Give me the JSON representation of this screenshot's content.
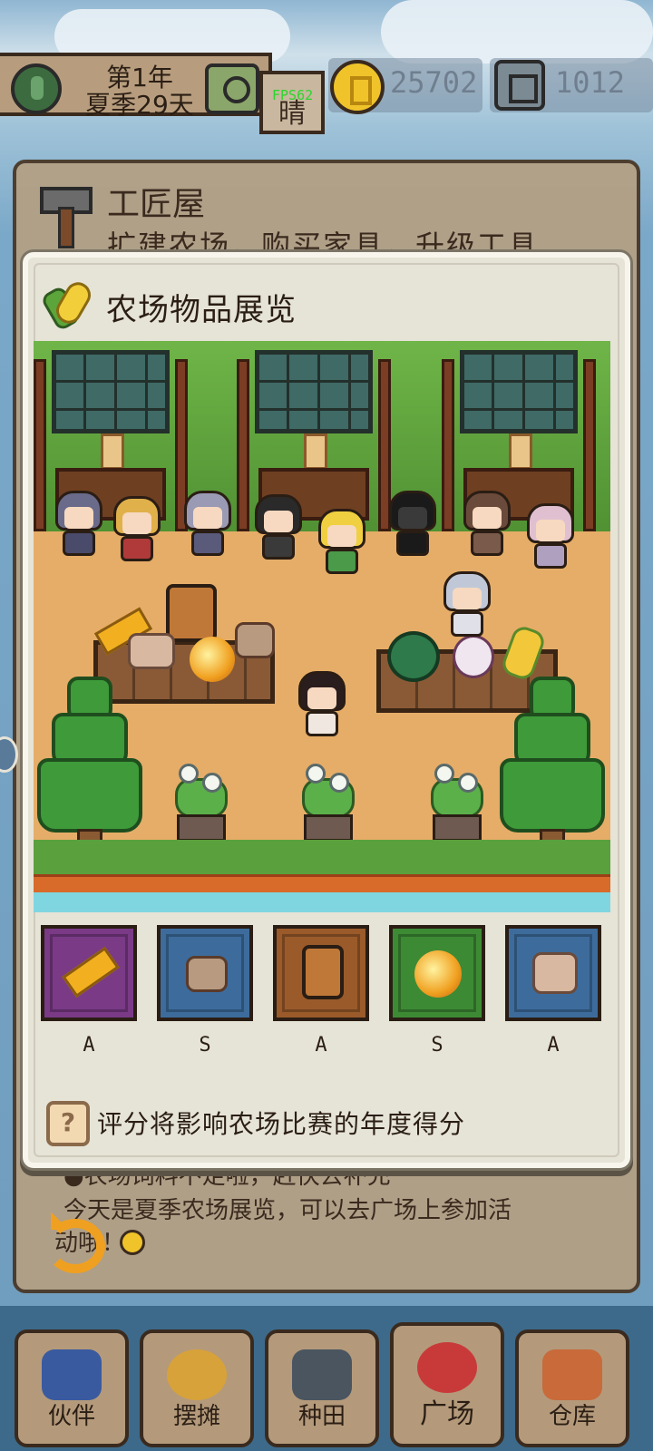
{
  "topbar": {
    "date_year": "第1年",
    "date_day": "夏季29天",
    "weather": "晴",
    "fps": "FPS62",
    "coins": "25702",
    "gems": "1012"
  },
  "background": {
    "shop_title": "工匠屋",
    "shop_subtitle": "扩建农场，购买家具，升级工具",
    "messages": [
      "●农场饲料不足啦，赶快去补充",
      "今天是夏季农场展览，可以去广场上参加活",
      "动哦！"
    ]
  },
  "modal": {
    "title": "农场物品展览",
    "items": [
      {
        "name": "corn-cob",
        "grade": "A",
        "bg": "#7a3a86"
      },
      {
        "name": "ginger-root",
        "grade": "S",
        "bg": "#3d6c9c"
      },
      {
        "name": "jam-jar",
        "grade": "A",
        "bg": "#9a5a2a"
      },
      {
        "name": "golden-fruit",
        "grade": "S",
        "bg": "#3d8a34"
      },
      {
        "name": "ginger-root",
        "grade": "A",
        "bg": "#3d6c9c"
      }
    ],
    "hint_icon": "?",
    "hint": "评分将影响农场比赛的年度得分"
  },
  "nav": [
    {
      "label": "伙伴",
      "icon": "partner-icon"
    },
    {
      "label": "摆摊",
      "icon": "stall-icon"
    },
    {
      "label": "种田",
      "icon": "farming-icon"
    },
    {
      "label": "广场",
      "icon": "plaza-icon"
    },
    {
      "label": "仓库",
      "icon": "warehouse-icon"
    }
  ],
  "colors": {
    "modal_bg": "#e6e3d7",
    "accent_gold": "#f0c32a",
    "fps_green": "#2bd62b"
  }
}
